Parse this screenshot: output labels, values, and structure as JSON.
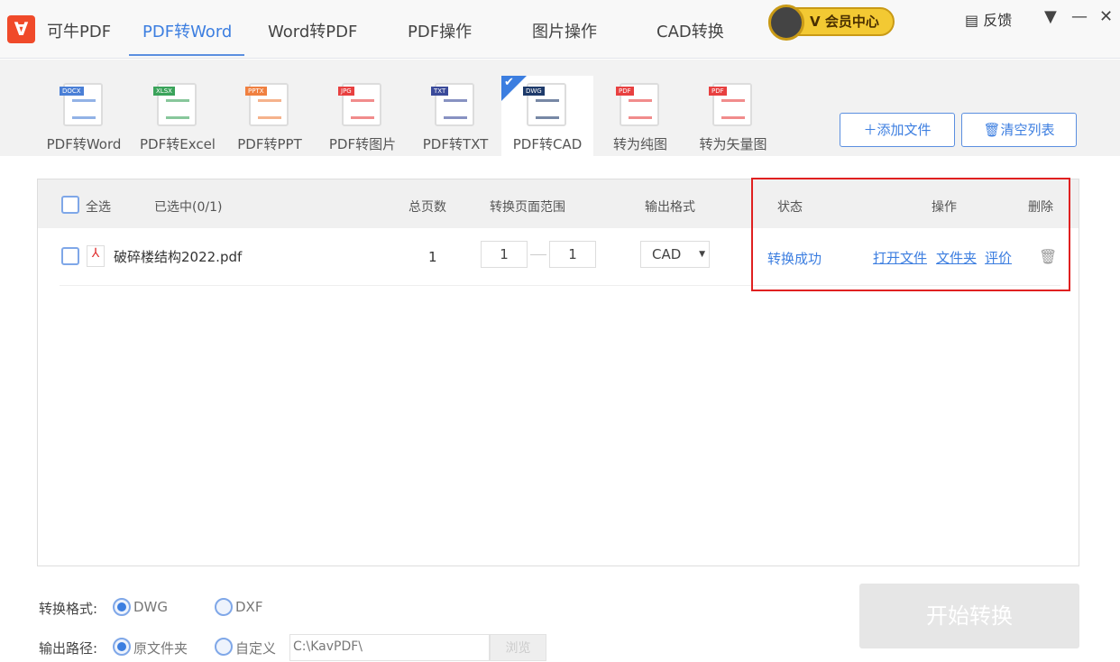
{
  "app": {
    "logo_text": "可牛PDF",
    "nav": [
      "PDF转Word",
      "Word转PDF",
      "PDF操作",
      "图片操作",
      "CAD转换"
    ],
    "vip": "会员中心",
    "feedback": "反馈"
  },
  "tools": [
    {
      "label": "PDF转Word",
      "tag": "DOCX",
      "color": "#4a7fd6"
    },
    {
      "label": "PDF转Excel",
      "tag": "XLSX",
      "color": "#3aa35a"
    },
    {
      "label": "PDF转PPT",
      "tag": "PPTX",
      "color": "#f08040"
    },
    {
      "label": "PDF转图片",
      "tag": "JPG",
      "color": "#e84040"
    },
    {
      "label": "PDF转TXT",
      "tag": "TXT",
      "color": "#3a4a9a"
    },
    {
      "label": "PDF转CAD",
      "tag": "DWG",
      "color": "#1e3a6a"
    },
    {
      "label": "转为纯图",
      "tag": "PDF",
      "color": "#e84040"
    },
    {
      "label": "转为矢量图",
      "tag": "PDF",
      "color": "#e84040"
    }
  ],
  "buttons": {
    "add": "添加文件",
    "clear": "清空列表",
    "start": "开始转换",
    "browse": "浏览"
  },
  "table": {
    "select_all": "全选",
    "selected": "已选中(0/1)",
    "headers": {
      "pages": "总页数",
      "range": "转换页面范围",
      "format": "输出格式",
      "status": "状态",
      "actions": "操作",
      "delete": "删除"
    },
    "rows": [
      {
        "name": "破碎楼结构2022.pdf",
        "pages": "1",
        "from": "1",
        "to": "1",
        "format": "CAD",
        "status": "转换成功",
        "open": "打开文件",
        "folder": "文件夹",
        "rate": "评价"
      }
    ]
  },
  "options": {
    "format_label": "转换格式:",
    "formats": [
      "DWG",
      "DXF"
    ],
    "path_label": "输出路径:",
    "paths": [
      "原文件夹",
      "自定义"
    ],
    "path_value": "C:\\KavPDF\\"
  }
}
